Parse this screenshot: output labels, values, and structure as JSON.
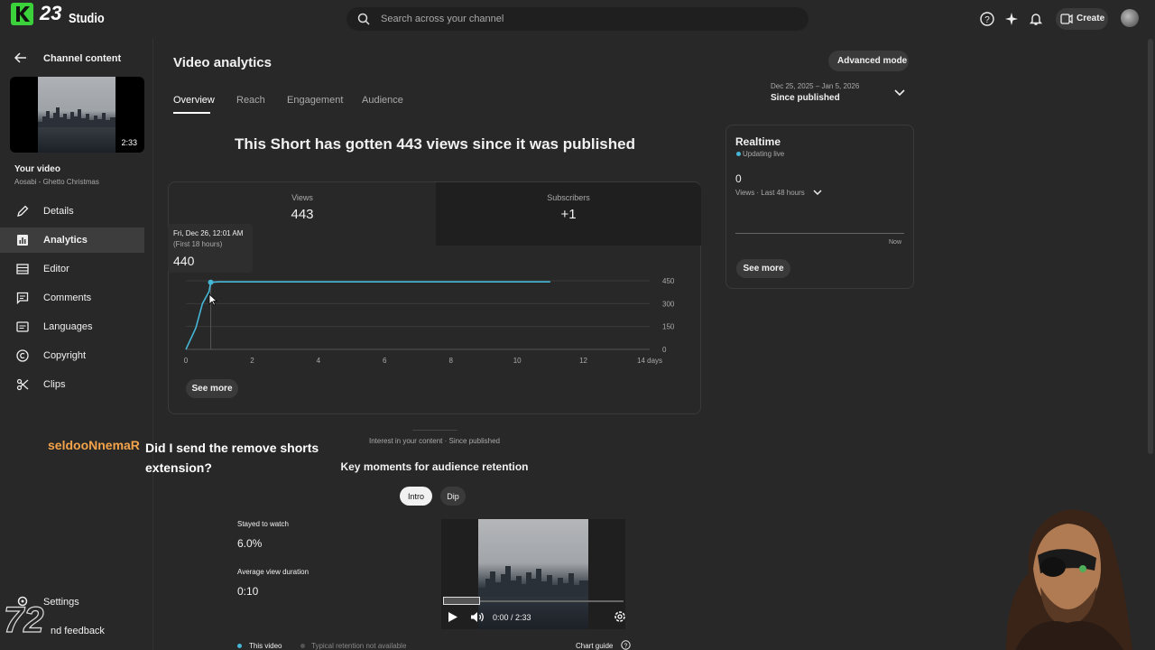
{
  "app": {
    "logo_number": "23",
    "logo_text": "Studio"
  },
  "search": {
    "placeholder": "Search across your channel"
  },
  "header": {
    "create_label": "Create"
  },
  "sidebar": {
    "back_label": "Channel content",
    "thumb_duration": "2:33",
    "your_video_label": "Your video",
    "video_title": "Aosabi - Ghetto Christmas",
    "items": [
      {
        "label": "Details",
        "icon": "pencil-icon"
      },
      {
        "label": "Analytics",
        "icon": "analytics-icon"
      },
      {
        "label": "Editor",
        "icon": "editor-icon"
      },
      {
        "label": "Comments",
        "icon": "comments-icon"
      },
      {
        "label": "Languages",
        "icon": "languages-icon"
      },
      {
        "label": "Copyright",
        "icon": "copyright-icon"
      },
      {
        "label": "Clips",
        "icon": "scissors-icon"
      }
    ],
    "settings_label": "Settings",
    "feedback_label": "nd feedback"
  },
  "page": {
    "title": "Video analytics",
    "tabs": [
      "Overview",
      "Reach",
      "Engagement",
      "Audience"
    ],
    "active_tab": "Overview",
    "advanced_mode_label": "Advanced mode",
    "date_range": "Dec 25, 2025 – Jan 5, 2026",
    "date_label": "Since published",
    "headline": "This Short has gotten 443 views since it was published"
  },
  "metrics": [
    {
      "label": "Views",
      "value": "443"
    },
    {
      "label": "Subscribers",
      "value": "+1"
    }
  ],
  "tooltip": {
    "date": "Fri, Dec 26, 12:01 AM",
    "sub": "(First 18 hours)",
    "value": "440"
  },
  "chart_data": {
    "type": "line",
    "x": [
      0,
      0.3,
      0.5,
      0.7,
      0.75,
      1,
      2,
      4,
      6,
      8,
      10,
      11
    ],
    "values": [
      0,
      140,
      300,
      380,
      440,
      443,
      443,
      443,
      443,
      443,
      443,
      443
    ],
    "x_ticks": [
      "0",
      "2",
      "4",
      "6",
      "8",
      "10",
      "12",
      "14 days"
    ],
    "y_ticks": [
      "450",
      "300",
      "150",
      "0"
    ],
    "xlim": [
      0,
      14
    ],
    "ylim": [
      0,
      450
    ],
    "grid": true,
    "line_color": "#45b6d6"
  },
  "main_see_more": "See more",
  "realtime": {
    "title": "Realtime",
    "status": "Updating live",
    "value": "0",
    "period": "Views · Last 48 hours",
    "now_label": "Now",
    "see_more": "See more"
  },
  "retention": {
    "interest_label": "Interest in your content · Since published",
    "title": "Key moments for audience retention",
    "buttons": [
      "Intro",
      "Dip"
    ],
    "stayed_label": "Stayed to watch",
    "stayed_value": "6.0%",
    "avg_label": "Average view duration",
    "avg_value": "0:10",
    "video_time": "0:00 / 2:33",
    "legend_this": "This video",
    "legend_typical": "Typical retention not available",
    "chart_guide": "Chart guide"
  },
  "overlay": {
    "chat_user": "seldooNnemaR",
    "chat_message": "Did I send the remove shorts extension?",
    "watermark": "72"
  },
  "colors": {
    "accent_green": "#3ad13a",
    "chat_user": "#f3a34a",
    "chart_line": "#45b6d6"
  }
}
